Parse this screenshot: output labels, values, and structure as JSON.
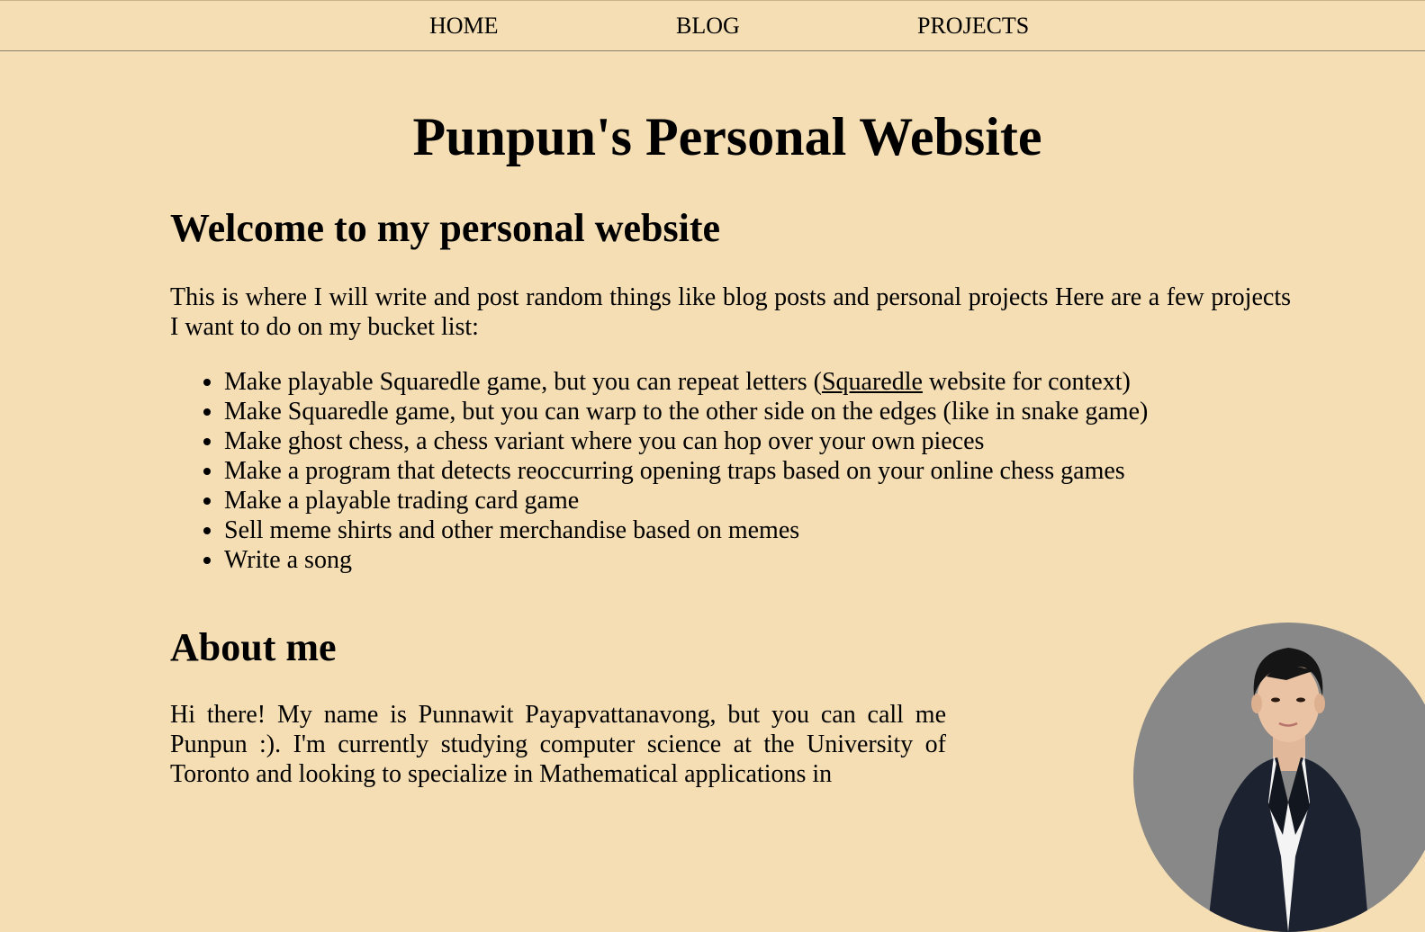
{
  "nav": {
    "home": "HOME",
    "blog": "BLOG",
    "projects": "PROJECTS"
  },
  "site_title": "Punpun's Personal Website",
  "welcome": {
    "heading": "Welcome to my personal website",
    "intro": "This is where I will write and post random things like blog posts and personal projects Here are a few projects I want to do on my bucket list:",
    "bucket_list": [
      {
        "before": "Make playable Squaredle game, but you can repeat letters (",
        "link": "Squaredle",
        "after": " website for context)"
      },
      {
        "text": "Make Squaredle game, but you can warp to the other side on the edges (like in snake game)"
      },
      {
        "text": "Make ghost chess, a chess variant where you can hop over your own pieces"
      },
      {
        "text": "Make a program that detects reoccurring opening traps based on your online chess games"
      },
      {
        "text": "Make a playable trading card game"
      },
      {
        "text": "Sell meme shirts and other merchandise based on memes"
      },
      {
        "text": "Write a song"
      }
    ]
  },
  "about": {
    "heading": "About me",
    "text": "Hi there! My name is Punnawit Payapvattanavong, but you can call me Punpun :). I'm currently studying computer science at the University of Toronto and looking to specialize in Mathematical applications in"
  },
  "colors": {
    "background": "#f5deb3",
    "portrait_bg": "#888888"
  }
}
